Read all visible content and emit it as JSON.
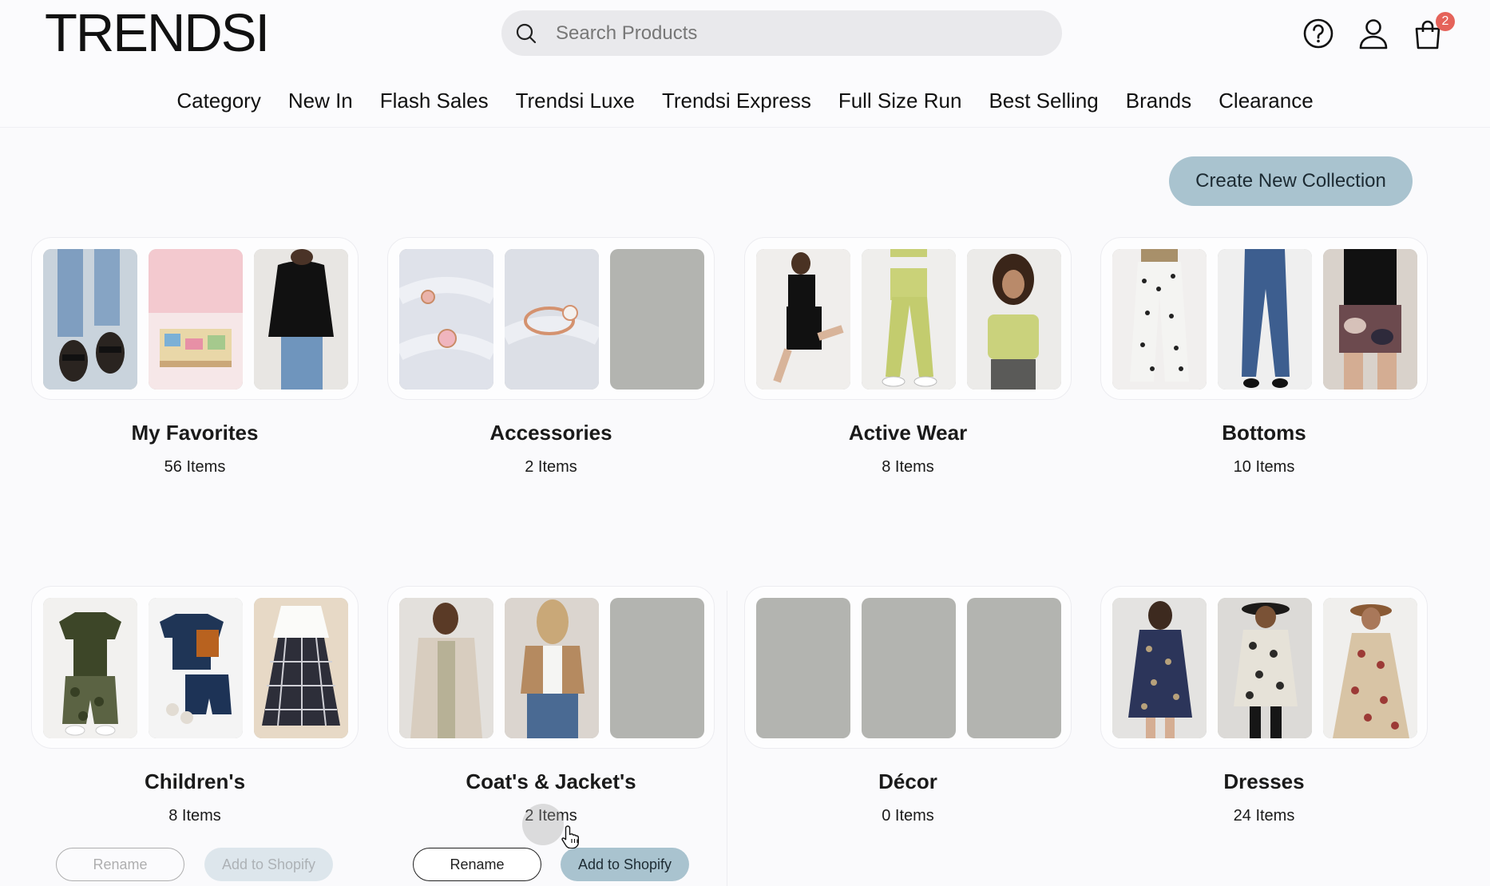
{
  "brand": {
    "logo_text": "TRENDSI"
  },
  "search": {
    "placeholder": "Search Products"
  },
  "header_icons": {
    "help": "help-circle-icon",
    "account": "user-icon",
    "cart": "shopping-bag-icon",
    "cart_count": "2"
  },
  "nav": [
    {
      "label": "Category"
    },
    {
      "label": "New In"
    },
    {
      "label": "Flash Sales"
    },
    {
      "label": "Trendsi Luxe"
    },
    {
      "label": "Trendsi Express"
    },
    {
      "label": "Full Size Run"
    },
    {
      "label": "Best Selling"
    },
    {
      "label": "Brands"
    },
    {
      "label": "Clearance"
    }
  ],
  "actions": {
    "create_collection": "Create New Collection"
  },
  "collections": [
    {
      "title": "My Favorites",
      "count": "56 Items"
    },
    {
      "title": "Accessories",
      "count": "2 Items"
    },
    {
      "title": "Active Wear",
      "count": "8 Items"
    },
    {
      "title": "Bottoms",
      "count": "10 Items"
    },
    {
      "title": "Children's",
      "count": "8 Items"
    },
    {
      "title": "Coat's & Jacket's",
      "count": "2 Items"
    },
    {
      "title": "Décor",
      "count": "0 Items"
    },
    {
      "title": "Dresses",
      "count": "24 Items"
    }
  ],
  "card_actions": {
    "rename": "Rename",
    "add_to_shopify": "Add to Shopify"
  },
  "colors": {
    "accent": "#a9c3cf",
    "badge": "#e5635a",
    "placeholder": "#b3b4b0",
    "background": "#fafafc"
  }
}
